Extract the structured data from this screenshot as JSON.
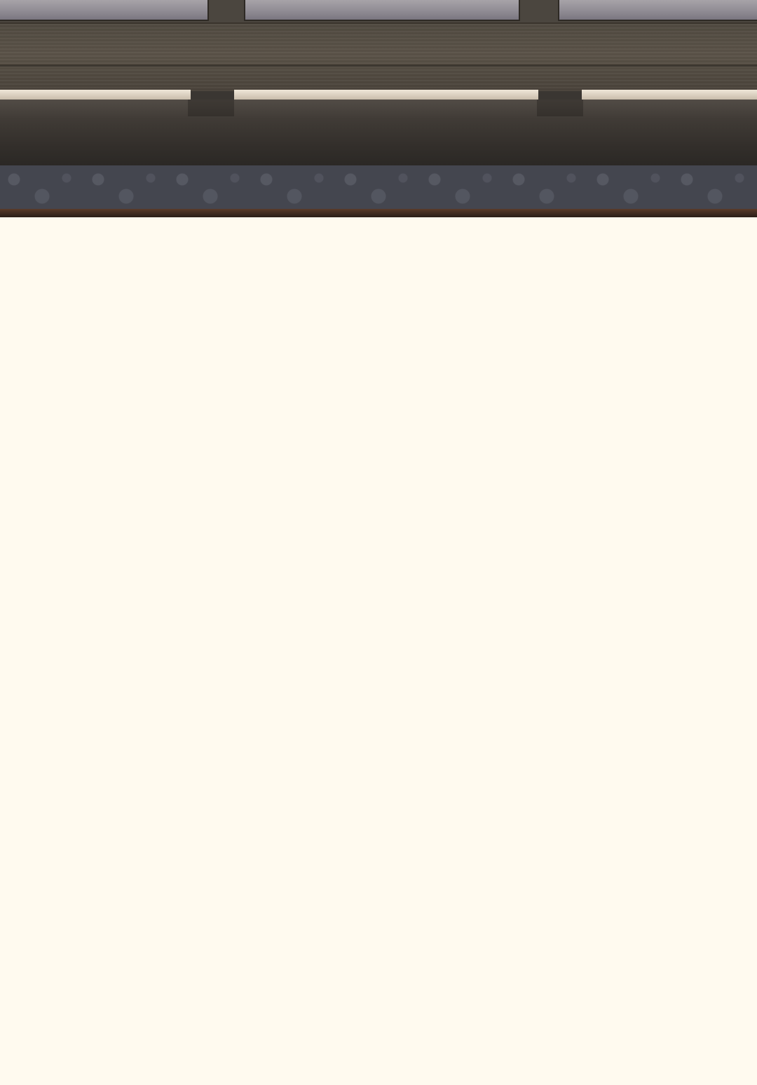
{
  "scene": {
    "backdrop": "window-sill-wallpaper",
    "colors": {
      "page_background": "#fffaef",
      "sill": "#3a3632",
      "wallpaper": "#44464f",
      "trim": "#3d2a20",
      "glass": "#8e8a92"
    }
  }
}
